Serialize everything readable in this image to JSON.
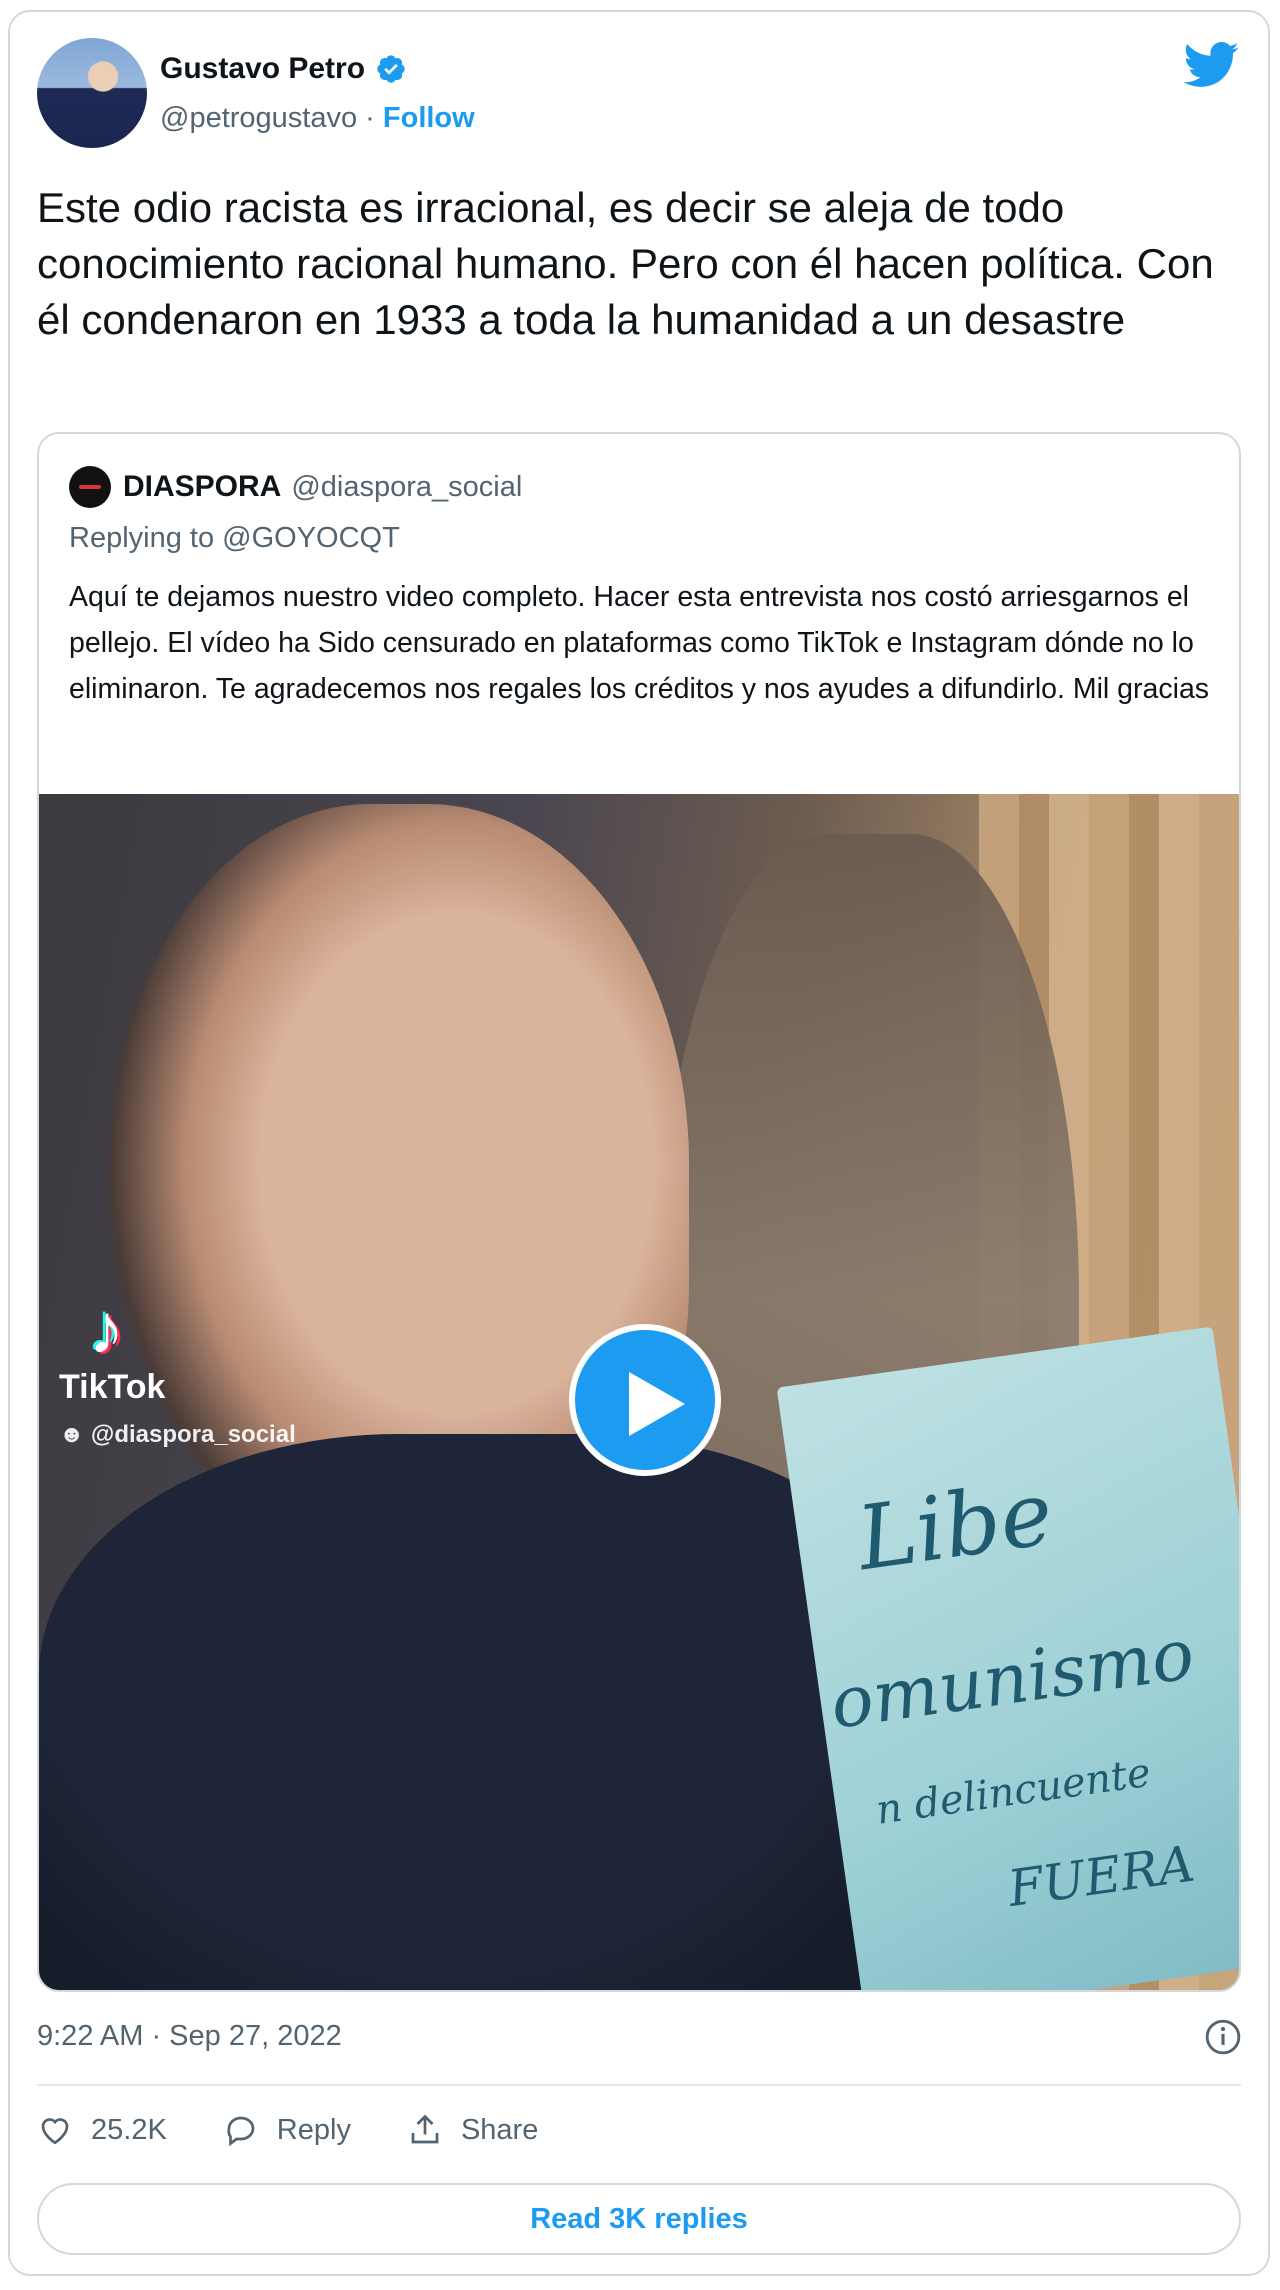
{
  "author": {
    "name": "Gustavo Petro",
    "handle": "@petrogustavo",
    "separator": " · ",
    "follow_label": "Follow",
    "avatar_icon": "avatar",
    "verified_icon": "verified-badge-icon"
  },
  "tweet": {
    "text": "Este odio racista es irracional, es decir se aleja de todo conocimiento racional humano. Pero con él hacen política. Con él condenaron en 1933 a toda la humanidad a un desastre",
    "timestamp": "9:22 AM · Sep 27, 2022"
  },
  "quoted": {
    "name": "DIASPORA",
    "handle": "@diaspora_social",
    "replying_to": "Replying to @GOYOCQT",
    "text": "Aquí te dejamos nuestro video completo. Hacer esta entrevista nos costó arriesgarnos el pellejo. El vídeo ha Sido censurado en plataformas como TikTok e Instagram dónde no lo eliminaron. Te agradecemos nos regales los créditos y nos ayudes a difundirlo. Mil gracias",
    "media": {
      "watermark_brand": "TikTok",
      "watermark_user": "@diaspora_social",
      "sign_text_1": "Libe",
      "sign_text_2": "omunismo",
      "sign_text_3": "n delincuente",
      "sign_text_4": "FUERA"
    }
  },
  "actions": {
    "likes": "25.2K",
    "reply_label": "Reply",
    "share_label": "Share"
  },
  "read_replies_label": "Read 3K replies",
  "colors": {
    "accent": "#1d9bf0",
    "secondary_text": "#536471",
    "border": "#cfd9de"
  }
}
